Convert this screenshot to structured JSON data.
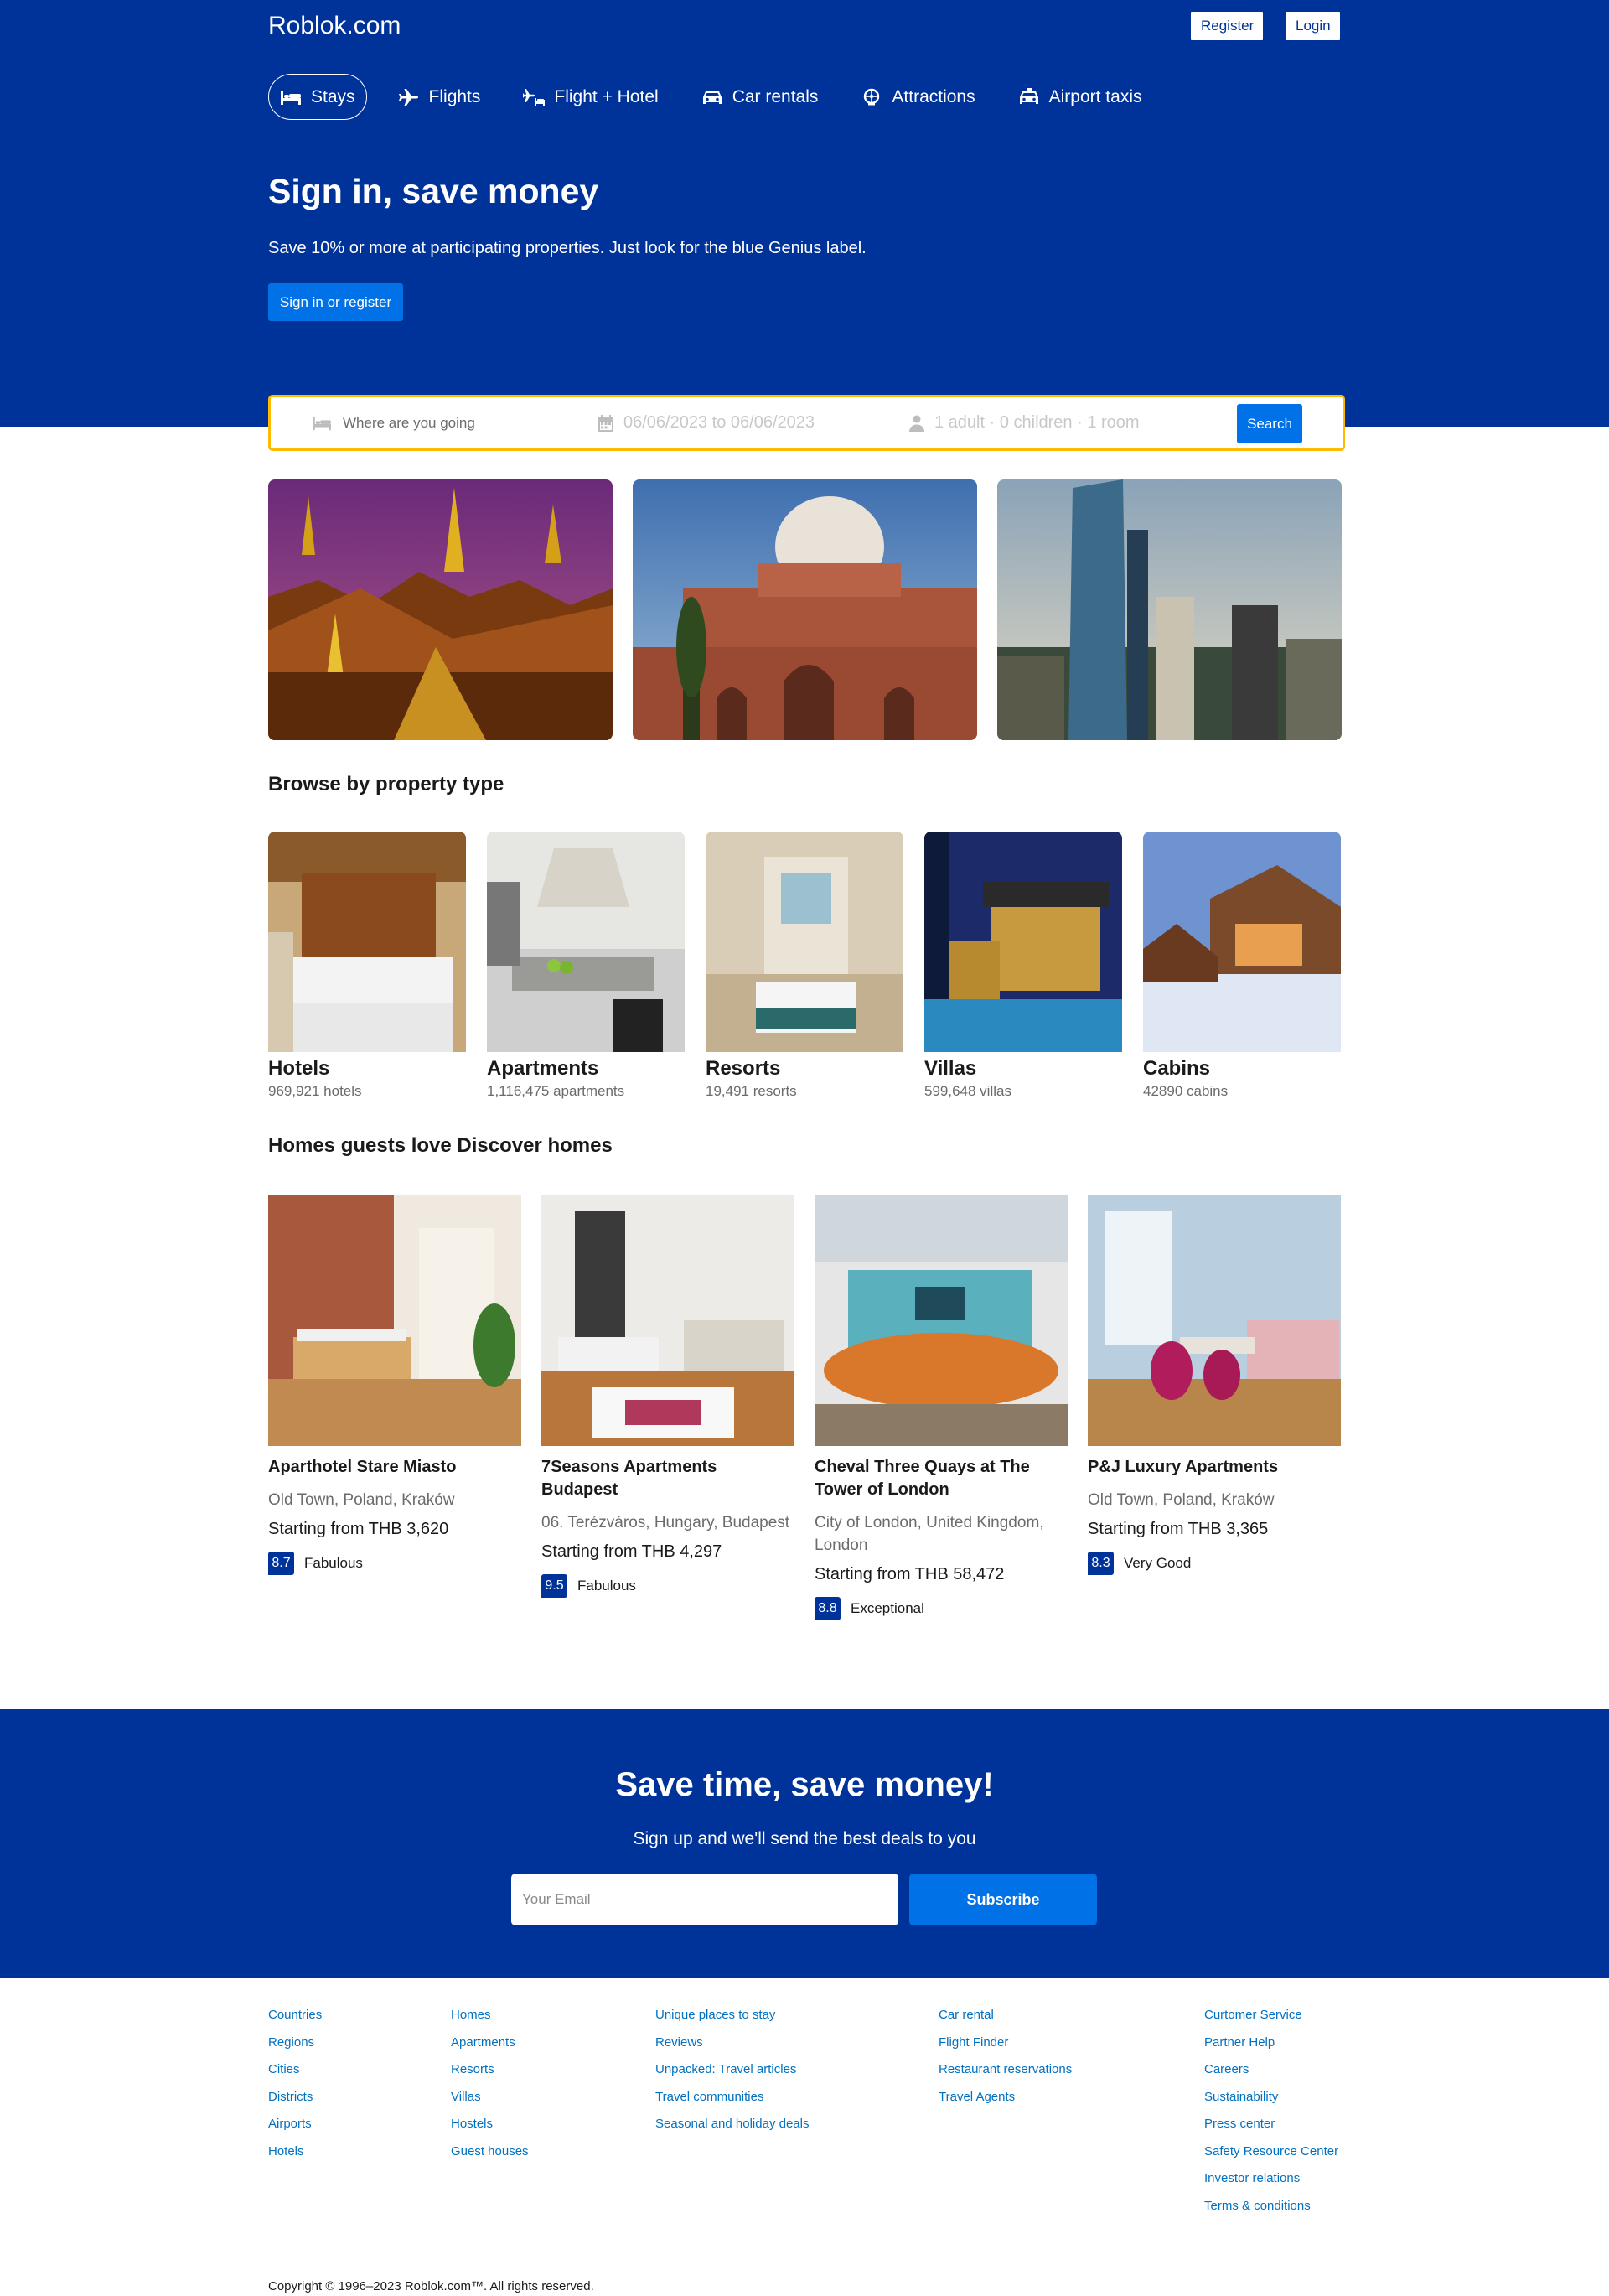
{
  "header": {
    "logo": "Roblok.com",
    "register_label": "Register",
    "login_label": "Login"
  },
  "nav": {
    "stays": "Stays",
    "flights": "Flights",
    "flight_hotel": "Flight + Hotel",
    "car_rentals": "Car rentals",
    "attractions": "Attractions",
    "airport_taxis": "Airport taxis"
  },
  "hero": {
    "title": "Sign in, save money",
    "subtitle": "Save 10% or more at participating properties. Just look for the blue Genius label.",
    "button": "Sign in or register"
  },
  "search": {
    "destination_placeholder": "Where are you going",
    "dates": "06/06/2023 to 06/06/2023",
    "guests": "1 adult · 0 children · 1 room",
    "button": "Search"
  },
  "property_section": {
    "title": "Browse by property type",
    "items": [
      {
        "name": "Hotels",
        "count": "969,921 hotels"
      },
      {
        "name": "Apartments",
        "count": "1,116,475 apartments"
      },
      {
        "name": "Resorts",
        "count": "19,491 resorts"
      },
      {
        "name": "Villas",
        "count": "599,648 villas"
      },
      {
        "name": "Cabins",
        "count": "42890 cabins"
      }
    ]
  },
  "homes_section": {
    "title": "Homes guests love Discover homes",
    "items": [
      {
        "name": "Aparthotel Stare Miasto",
        "location": "Old Town, Poland, Kraków",
        "price": "Starting from THB 3,620",
        "score": "8.7",
        "rating": "Fabulous"
      },
      {
        "name": "7Seasons Apartments Budapest",
        "location": "06. Terézváros, Hungary, Budapest",
        "price": "Starting from THB 4,297",
        "score": "9.5",
        "rating": "Fabulous"
      },
      {
        "name": "Cheval Three Quays at The Tower of London",
        "location": "City of London, United Kingdom, London",
        "price": "Starting from THB 58,472",
        "score": "8.8",
        "rating": "Exceptional"
      },
      {
        "name": "P&J Luxury Apartments",
        "location": "Old Town, Poland, Kraków",
        "price": "Starting from THB 3,365",
        "score": "8.3",
        "rating": "Very Good"
      }
    ]
  },
  "newsletter": {
    "title": "Save time, save money!",
    "subtitle": "Sign up and we'll send the best deals to you",
    "email_placeholder": "Your Email",
    "button": "Subscribe"
  },
  "footer": {
    "col1": [
      "Countries",
      "Regions",
      "Cities",
      "Districts",
      "Airports",
      "Hotels"
    ],
    "col2": [
      "Homes",
      "Apartments",
      "Resorts",
      "Villas",
      "Hostels",
      "Guest houses"
    ],
    "col3": [
      "Unique places to stay",
      "Reviews",
      "Unpacked: Travel articles",
      "Travel communities",
      "Seasonal and holiday deals"
    ],
    "col4": [
      "Car rental",
      "Flight Finder",
      "Restaurant reservations",
      "Travel Agents"
    ],
    "col5": [
      "Curtomer Service",
      "Partner Help",
      "Careers",
      "Sustainability",
      "Press center",
      "Safety Resource Center",
      "Investor relations",
      "Terms & conditions"
    ],
    "copyright": "Copyright © 1996–2023 Roblok.com™. All rights reserved."
  },
  "colors": {
    "brand": "#003399",
    "action": "#0071e6",
    "search_border": "#febb02",
    "link": "#0071c2"
  }
}
